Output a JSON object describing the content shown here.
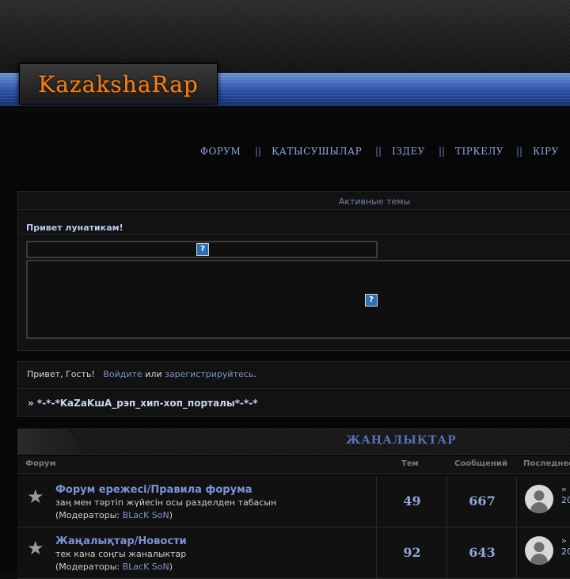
{
  "logo": {
    "text": "KazakshaRap"
  },
  "nav": {
    "items": [
      "ФОРУМ",
      "ҚАТЫСУШЫЛАР",
      "ІЗДЕУ",
      "ТІРКЕЛУ",
      "КІРУ"
    ],
    "separator": "||"
  },
  "active_topics": {
    "title": "Активные темы",
    "greeting": "Привет лунатикам!",
    "missing_image_label": "?"
  },
  "guest_panel": {
    "prefix": "Привет, Гость!",
    "login_link": "Войдите",
    "or_text": "или",
    "register_link": "зарегистрируйтесь",
    "suffix": ".",
    "breadcrumb": "» *-*-*KaZaKшA_рэп_хип-хоп_порталы*-*-*"
  },
  "category": {
    "title": "ЖАҢАЛЫҚТАР"
  },
  "columns": {
    "forum": "Форум",
    "topics": "Тем",
    "posts": "Сообщений",
    "last": "Последнее"
  },
  "forums": [
    {
      "title": "Форум ережесі/Правила форума",
      "description": "заң мен тәртіп жүйесін осы разделден табасын",
      "mods_prefix": "(Модераторы: ",
      "mods_name": "BLacK SoN",
      "mods_suffix": ")",
      "topics": "49",
      "posts": "667",
      "last_link": "»",
      "last_date": "20"
    },
    {
      "title": "Жаңалықтар/Новости",
      "description": "тек кана соңгы жаналыктар",
      "mods_prefix": "(Модераторы: ",
      "mods_name": "BLacK SoN",
      "mods_suffix": ")",
      "topics": "92",
      "posts": "643",
      "last_link": "»",
      "last_date": "20"
    }
  ]
}
